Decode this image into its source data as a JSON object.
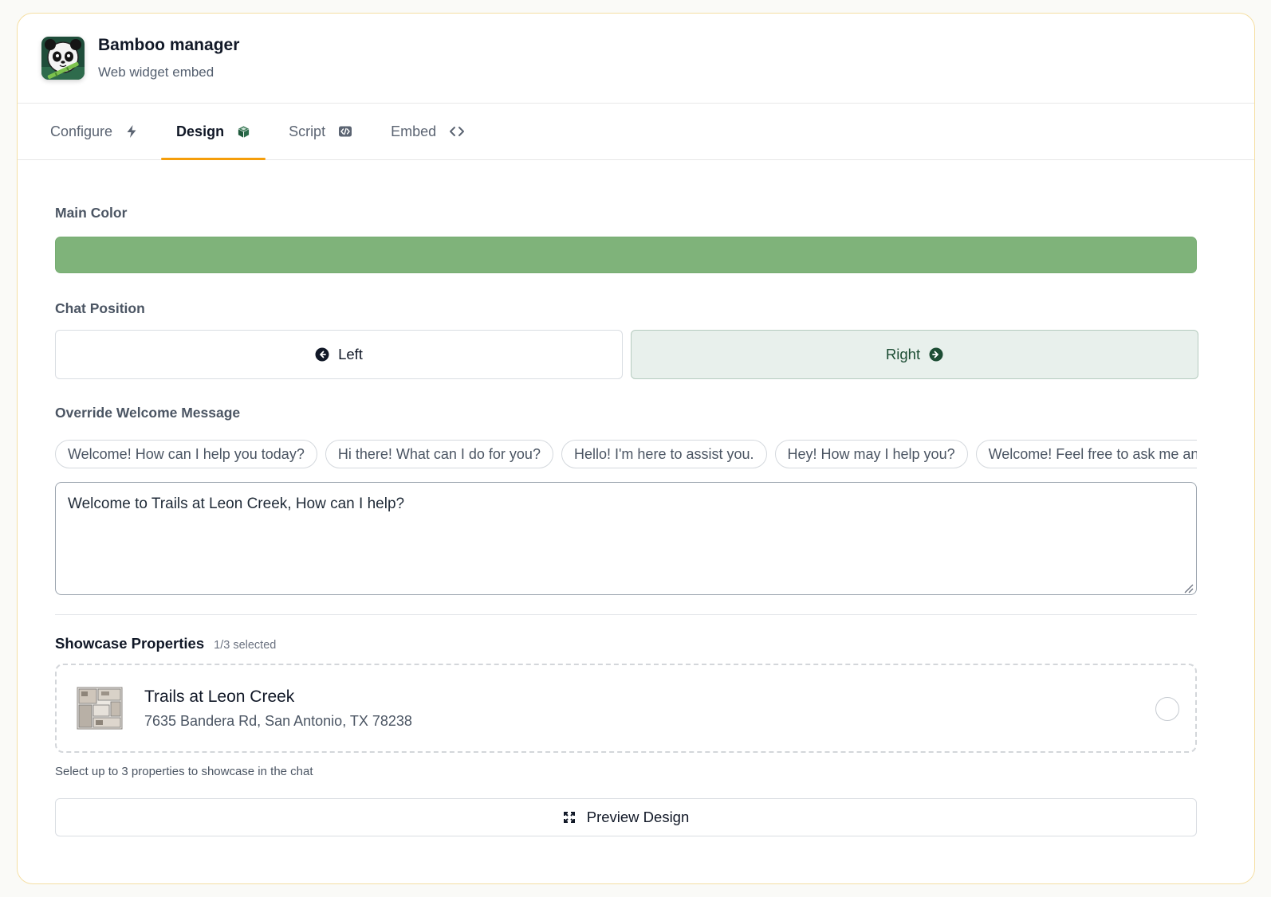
{
  "header": {
    "title": "Bamboo manager",
    "subtitle": "Web widget embed",
    "logo_icon": "panda-logo-icon"
  },
  "tabs": [
    {
      "label": "Configure",
      "icon": "bolt-icon",
      "active": false
    },
    {
      "label": "Design",
      "icon": "cube-icon",
      "active": true
    },
    {
      "label": "Script",
      "icon": "code-badge-icon",
      "active": false
    },
    {
      "label": "Embed",
      "icon": "angle-brackets-icon",
      "active": false
    }
  ],
  "design": {
    "main_color_label": "Main Color",
    "main_color": "#7fb37a",
    "chat_position_label": "Chat Position",
    "position_left_label": "Left",
    "position_right_label": "Right",
    "selected_position": "Right",
    "welcome_label": "Override Welcome Message",
    "welcome_suggestions": [
      "Welcome! How can I help you today?",
      "Hi there! What can I do for you?",
      "Hello! I'm here to assist you.",
      "Hey! How may I help you?",
      "Welcome! Feel free to ask me anything."
    ],
    "welcome_message": "Welcome to Trails at Leon Creek, How can I help?",
    "showcase_title": "Showcase Properties",
    "showcase_count": "1/3 selected",
    "properties": [
      {
        "name": "Trails at Leon Creek",
        "address": "7635 Bandera Rd, San Antonio, TX 78238",
        "selected": false
      }
    ],
    "showcase_hint": "Select up to 3 properties to showcase in the chat",
    "preview_label": "Preview Design"
  },
  "colors": {
    "accent_tab": "#f59e0b",
    "selected_position_bg": "#e8f0ec",
    "selected_position_text": "#1d4d34"
  }
}
